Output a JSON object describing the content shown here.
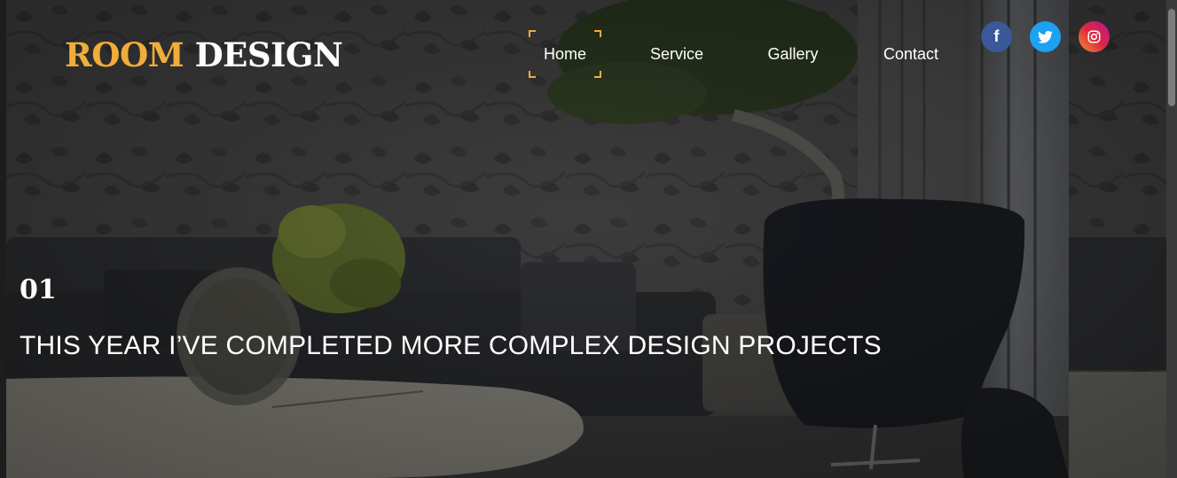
{
  "brand": {
    "part1": "ROOM",
    "part2": "DESIGN",
    "accent_color": "#f0ad3a"
  },
  "nav": {
    "items": [
      {
        "label": "Home",
        "active": true
      },
      {
        "label": "Service",
        "active": false
      },
      {
        "label": "Gallery",
        "active": false
      },
      {
        "label": "Contact",
        "active": false
      }
    ]
  },
  "social": [
    {
      "icon": "facebook-icon",
      "glyph": "f",
      "color": "#3b5998"
    },
    {
      "icon": "twitter-icon",
      "color": "#1da1f2"
    },
    {
      "icon": "instagram-icon",
      "color": "#dc2743"
    }
  ],
  "hero": {
    "slide_number": "01",
    "headline": "THIS YEAR I’VE COMPLETED MORE COMPLEX DESIGN PROJECTS"
  }
}
